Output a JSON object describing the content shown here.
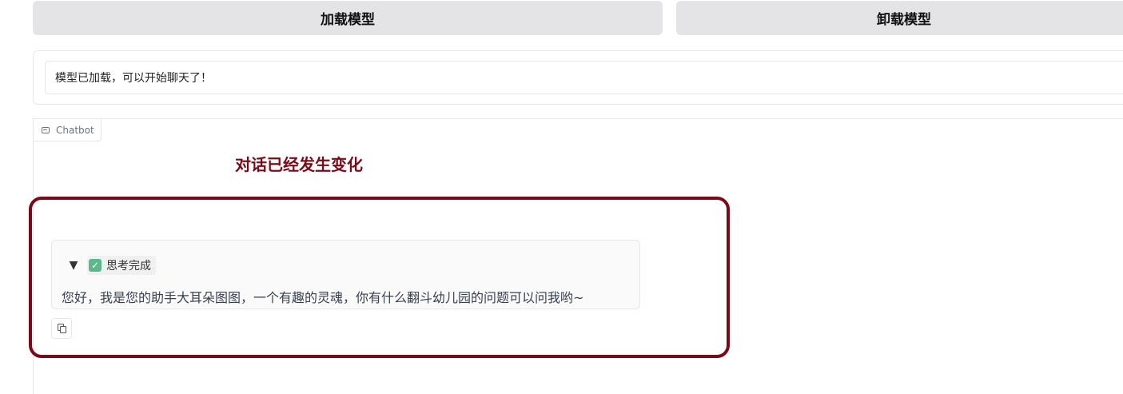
{
  "controls": {
    "load_label": "加载模型",
    "unload_label": "卸载模型"
  },
  "status": {
    "value": "模型已加载，可以开始聊天了！"
  },
  "chatbot": {
    "label": "Chatbot",
    "messages": [
      {
        "thinking_label": "思考完成",
        "text": "您好，我是您的助手大耳朵图图，一个有趣的灵魂，你有什么翻斗幼儿园的问题可以问我哟~"
      }
    ]
  },
  "annotation": {
    "text": "对话已经发生变化",
    "color": "#7b0a18"
  },
  "icons": {
    "chat": "chat-bubble-icon",
    "check": "check-icon",
    "copy": "copy-icon",
    "expand": "triangle-down-icon"
  }
}
